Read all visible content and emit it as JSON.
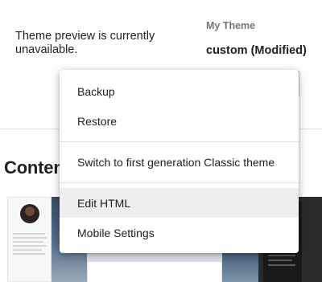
{
  "preview": {
    "message": "Theme preview is currently unavailable."
  },
  "theme": {
    "label": "My Theme",
    "name": "custom (Modified)"
  },
  "section": {
    "title_visible": "Conten"
  },
  "menu": {
    "items": [
      {
        "label": "Backup"
      },
      {
        "label": "Restore"
      },
      {
        "label": "Switch to first generation Classic theme"
      },
      {
        "label": "Edit HTML",
        "highlighted": true
      },
      {
        "label": "Mobile Settings"
      }
    ]
  },
  "colors": {
    "menu_highlight": "#eeeeee",
    "text_primary": "#202124",
    "text_secondary": "#757575",
    "divider": "#e0e0e0"
  }
}
